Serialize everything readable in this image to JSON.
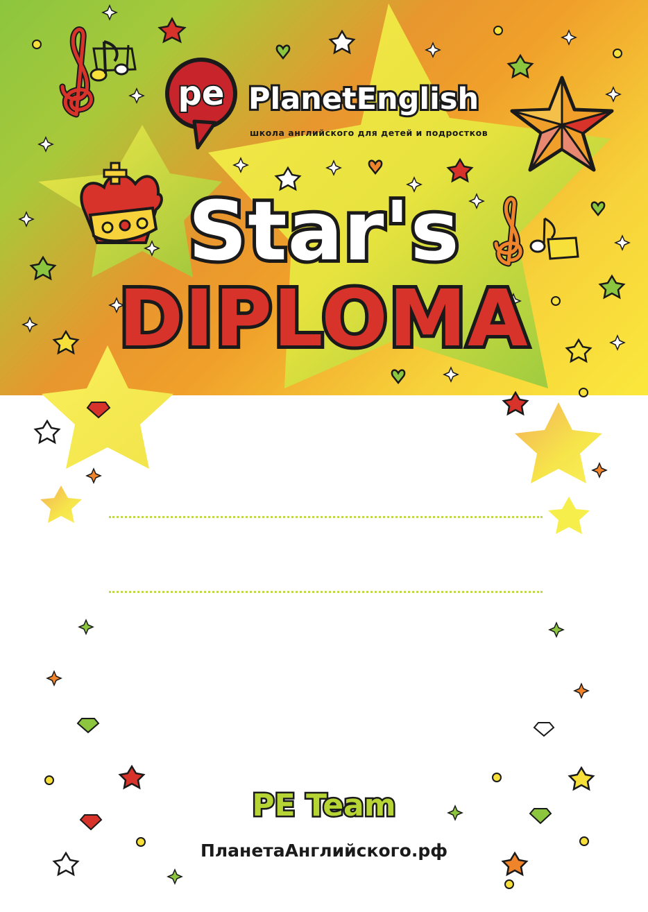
{
  "colors": {
    "accent_green": "#b6d433",
    "title_red": "#d7332a",
    "brand_red": "#c8242b",
    "outline": "#1a1a1a",
    "star_yellow": "#f7e84a"
  },
  "logo": {
    "mark": "pe",
    "name": "PlanetEnglish",
    "tagline": "школа английского для детей и подростков"
  },
  "title": {
    "line1": "Star's",
    "line2": "DIPLOMA"
  },
  "blanks": [
    "name-line",
    "details-line"
  ],
  "footer": {
    "team": "PE Team",
    "website": "ПланетаАнглийского.рф"
  },
  "decorations": [
    "treble-clef-icon",
    "crown-icon",
    "big-star-icon",
    "heart-icon",
    "diamond-icon",
    "star-icon",
    "sparkle-icon",
    "dot-icon"
  ]
}
